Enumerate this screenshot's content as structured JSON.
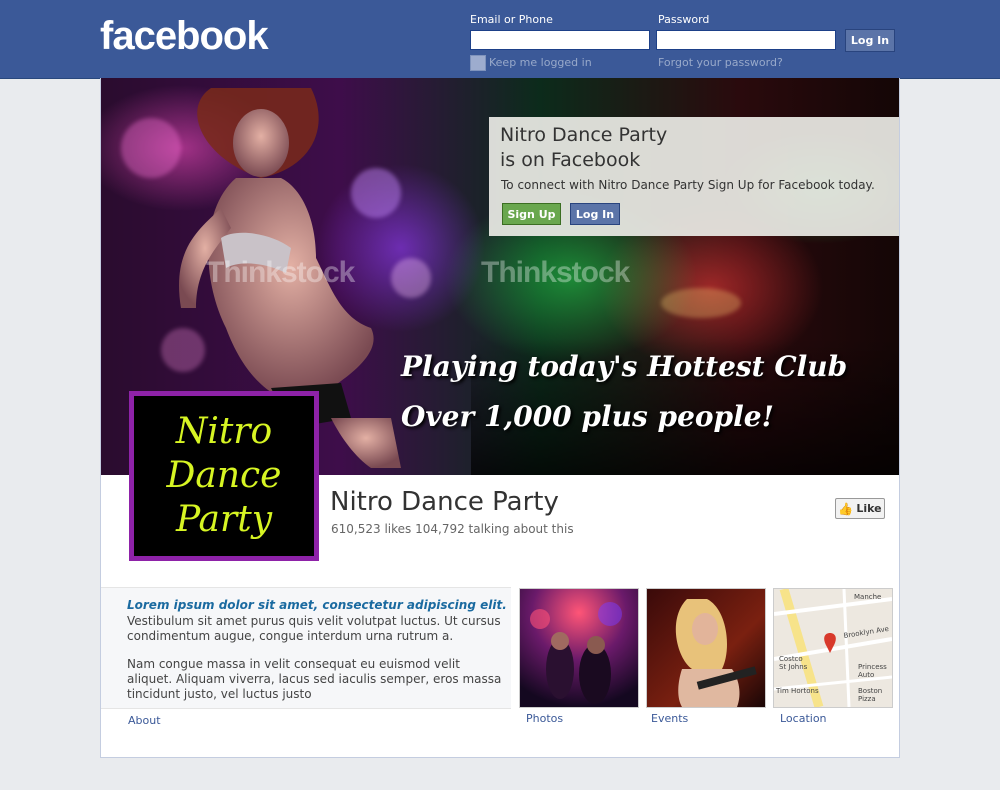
{
  "header": {
    "logo": "facebook",
    "email_label": "Email or Phone",
    "password_label": "Password",
    "login_button": "Log In",
    "keep_logged_in": "Keep me logged in",
    "forgot_password": "Forgot your password?"
  },
  "cover": {
    "watermark": "Thinkstock",
    "tagline_1": "Playing today's Hottest Club",
    "tagline_2": "Over 1,000 plus people!"
  },
  "signup_box": {
    "title_1": "Nitro Dance Party",
    "title_2": "is on Facebook",
    "text": "To connect with Nitro Dance Party Sign Up for Facebook today.",
    "signup_button": "Sign Up",
    "login_button": "Log In"
  },
  "profile": {
    "line_1": "Nitro",
    "line_2": "Dance",
    "line_3": "Party"
  },
  "page": {
    "name": "Nitro Dance Party",
    "likes": "610,523 likes",
    "talking": "104,792 talking about this",
    "like_button": "Like"
  },
  "about": {
    "heading": "Lorem ipsum dolor sit amet, consectetur adipiscing elit.",
    "para_1": "Vestibulum sit amet purus quis velit volutpat luctus. Ut cursus condimentum augue, congue interdum urna rutrum a.",
    "para_2": "Nam congue massa in velit consequat eu euismod velit aliquet. Aliquam viverra, lacus sed iaculis semper, eros massa tincidunt justo, vel luctus justo",
    "tab_label": "About"
  },
  "tabs": {
    "photos": "Photos",
    "events": "Events",
    "location": "Location"
  },
  "map_labels": {
    "street_1": "Brooklyn Ave",
    "street_2": "Manche",
    "place_1": "Costco",
    "place_1b": "St Johns",
    "place_2": "Princess",
    "place_2b": "Auto",
    "place_3": "Tim Hortons",
    "place_4": "Boston",
    "place_4b": "Pizza"
  },
  "colors": {
    "brand": "#3b5998",
    "signup_green": "#69a74e",
    "profile_border": "#8e22a8",
    "profile_text": "#d7f523"
  }
}
